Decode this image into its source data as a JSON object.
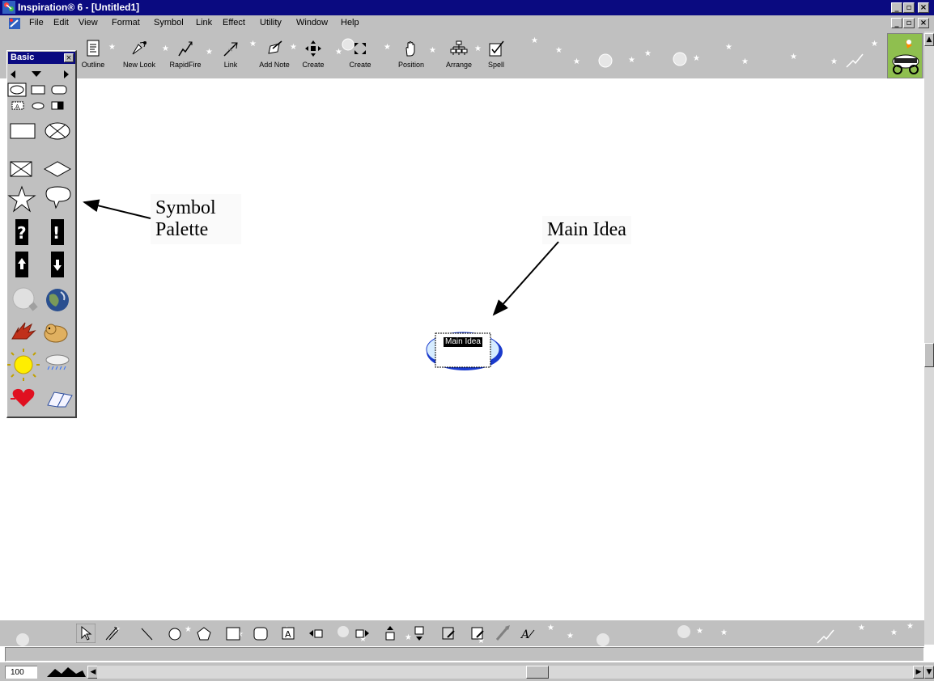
{
  "window": {
    "title": "Inspiration® 6 - [Untitled1]",
    "controls": [
      "_",
      "▫",
      "×"
    ]
  },
  "menu": {
    "items": [
      "File",
      "Edit",
      "View",
      "Format",
      "Symbol",
      "Link",
      "Effect",
      "Utility",
      "Window",
      "Help"
    ]
  },
  "toolbar": {
    "tools": [
      {
        "label": "Outline",
        "icon": "outline-icon"
      },
      {
        "label": "New Look",
        "icon": "new-look-icon"
      },
      {
        "label": "RapidFire",
        "icon": "rapidfire-icon"
      },
      {
        "label": "Link",
        "icon": "link-icon"
      },
      {
        "label": "Add Note",
        "icon": "add-note-icon"
      },
      {
        "label": "Create",
        "icon": "create-arrows-icon"
      },
      {
        "label": "Create",
        "icon": "create-expand-icon"
      },
      {
        "label": "Position",
        "icon": "hand-icon"
      },
      {
        "label": "Arrange",
        "icon": "arrange-icon"
      },
      {
        "label": "Spell",
        "icon": "spell-check-icon"
      }
    ]
  },
  "palette": {
    "title": "Basic",
    "close": "×"
  },
  "annotations": {
    "symbol_palette": [
      "Symbol",
      "Palette"
    ],
    "main_idea": "Main Idea"
  },
  "diagram": {
    "node_label": "Main Idea"
  },
  "status": {
    "zoom": "100"
  },
  "colors": {
    "titlebar": "#0a0a80",
    "chrome": "#c0c0c0",
    "node_fill": "#cfe8ff",
    "node_shadow": "#1a3acc"
  }
}
